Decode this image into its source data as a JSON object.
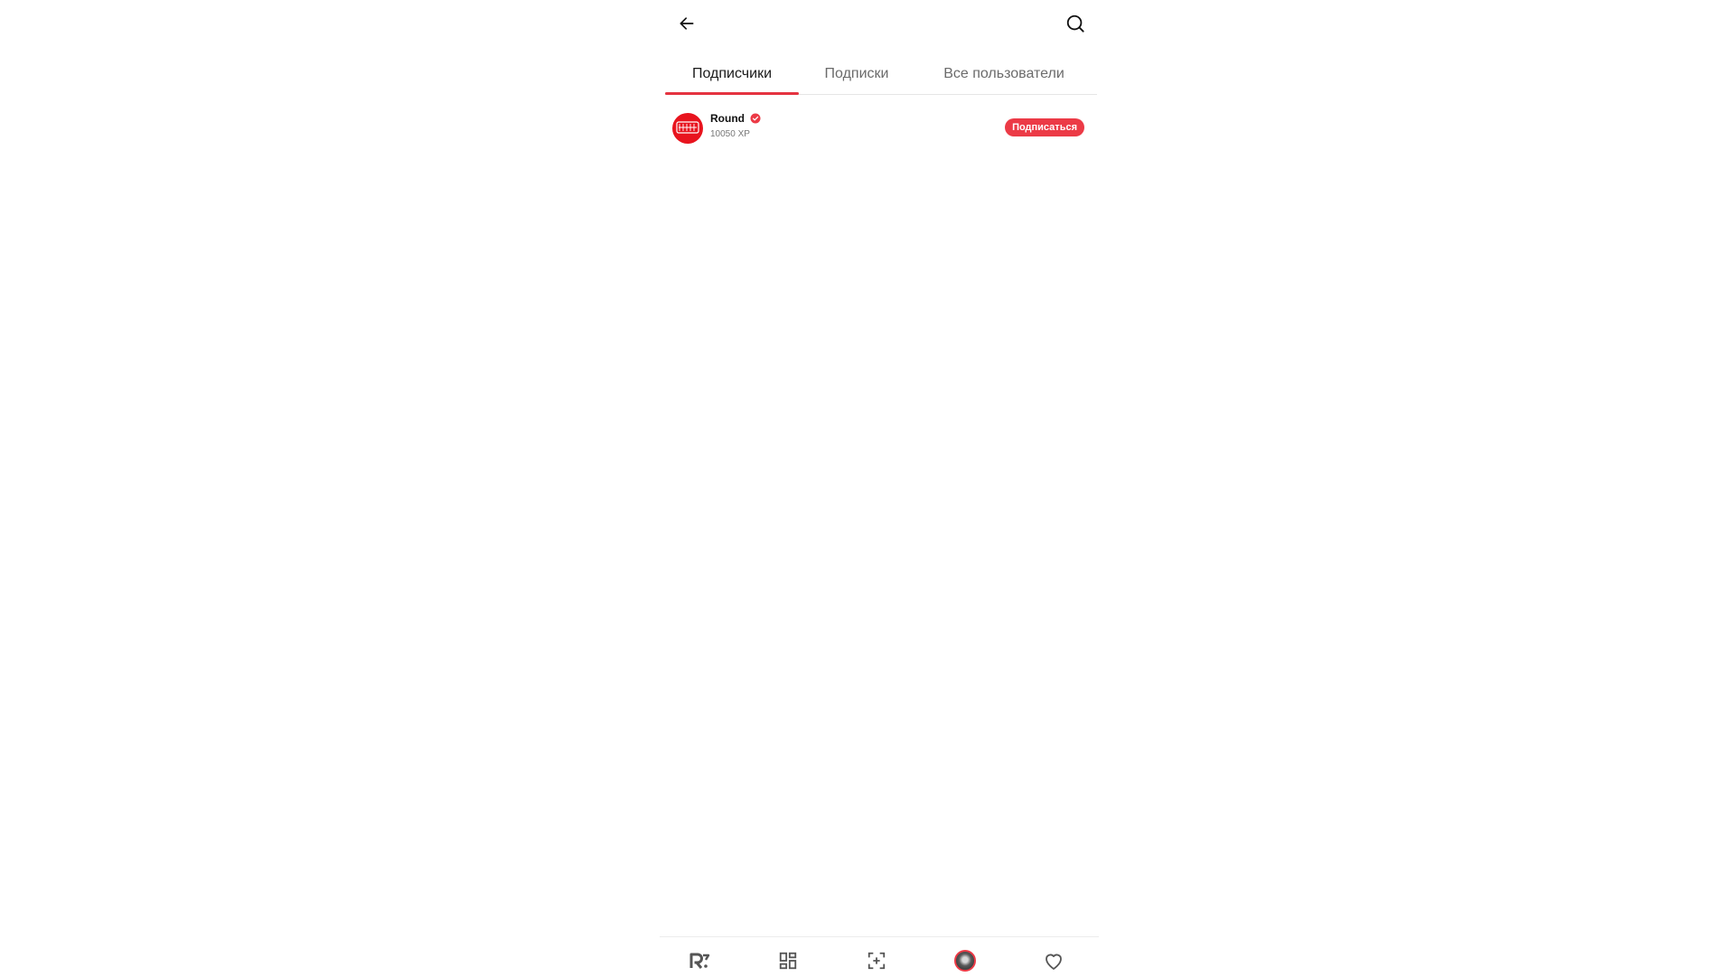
{
  "header": {
    "back_icon": "arrow-left-icon",
    "search_icon": "search-icon"
  },
  "tabs": [
    {
      "label": "Подписчики",
      "active": true
    },
    {
      "label": "Подписки",
      "active": false
    },
    {
      "label": "Все пользователи",
      "active": false
    }
  ],
  "users": [
    {
      "name": "Round",
      "verified": true,
      "xp": "10050 XP",
      "avatar_text": "ROUND",
      "subscribe_label": "Подписаться"
    }
  ],
  "bottom_nav": {
    "items": [
      {
        "icon": "app-logo-icon",
        "active": false
      },
      {
        "icon": "grid-icon",
        "active": false
      },
      {
        "icon": "create-post-icon",
        "active": false
      },
      {
        "icon": "profile-avatar-icon",
        "active": true
      },
      {
        "icon": "heart-icon",
        "active": false
      }
    ]
  },
  "colors": {
    "accent": "#ec3a46",
    "text_primary": "#1a1a1a",
    "text_secondary": "#6b6b6b"
  }
}
